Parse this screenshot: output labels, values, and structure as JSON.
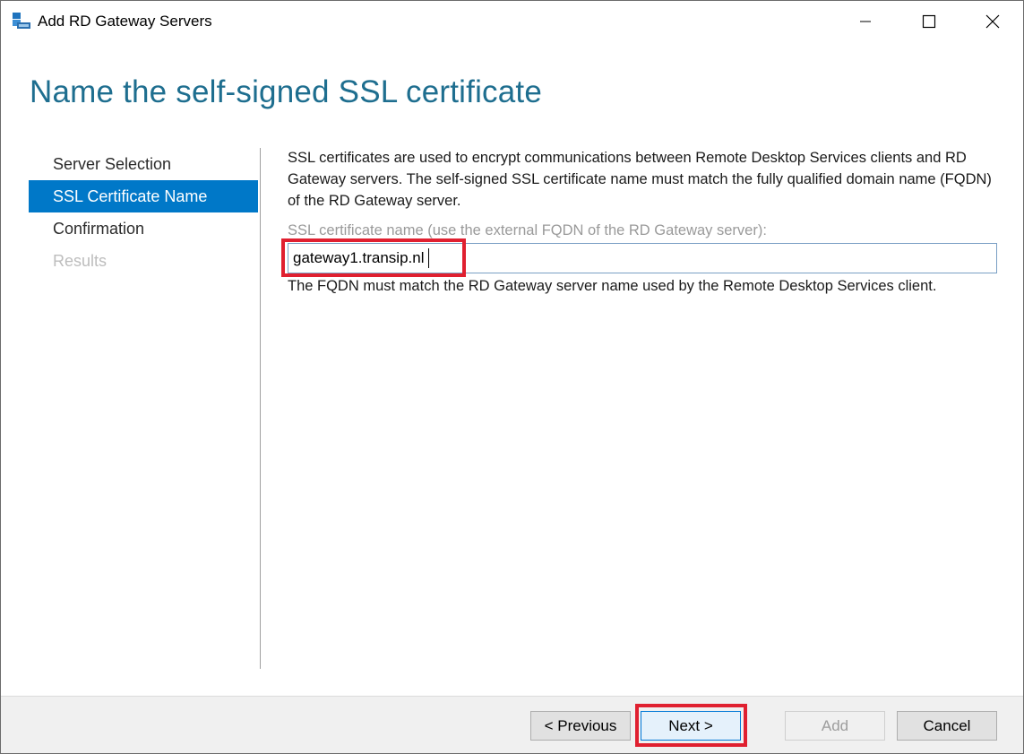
{
  "window": {
    "title": "Add RD Gateway Servers",
    "icon": "server-manager-icon"
  },
  "page": {
    "heading": "Name the self-signed SSL certificate"
  },
  "nav": {
    "items": [
      {
        "label": "Server Selection",
        "state": "normal"
      },
      {
        "label": "SSL Certificate Name",
        "state": "active"
      },
      {
        "label": "Confirmation",
        "state": "normal"
      },
      {
        "label": "Results",
        "state": "disabled"
      }
    ]
  },
  "content": {
    "description": "SSL certificates are used to encrypt communications between Remote Desktop Services clients and RD Gateway servers. The self-signed SSL certificate name must match the fully qualified domain name (FQDN) of the RD Gateway server.",
    "field_label": "SSL certificate name (use the external FQDN of the RD Gateway server):",
    "field_value": "gateway1.transip.nl",
    "hint": "The FQDN must match the RD Gateway server name used by the Remote Desktop Services client."
  },
  "buttons": {
    "previous": "< Previous",
    "next": "Next >",
    "add": "Add",
    "cancel": "Cancel"
  },
  "colors": {
    "accent": "#0078c8",
    "heading": "#1e6e8f",
    "highlight": "#e02030"
  }
}
